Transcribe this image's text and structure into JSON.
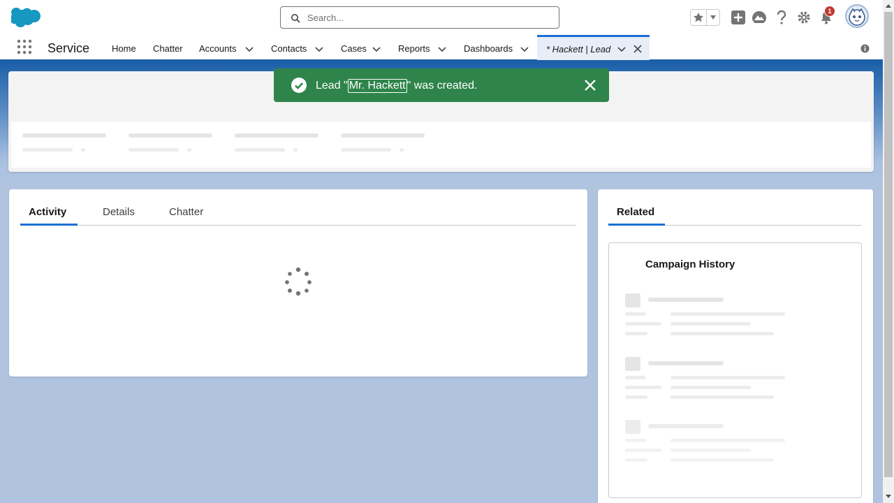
{
  "header": {
    "search_placeholder": "Search...",
    "notification_count": "1"
  },
  "nav": {
    "app_name": "Service",
    "items": [
      {
        "label": "Home"
      },
      {
        "label": "Chatter"
      },
      {
        "label": "Accounts"
      },
      {
        "label": "Contacts"
      },
      {
        "label": "Cases"
      },
      {
        "label": "Reports"
      },
      {
        "label": "Dashboards"
      }
    ],
    "active_tab_label": "* Hackett | Lead"
  },
  "toast": {
    "prefix": "Lead \"",
    "link": "Mr. Hackett",
    "suffix": "\" was created."
  },
  "main_tabs": {
    "activity": "Activity",
    "details": "Details",
    "chatter": "Chatter"
  },
  "side": {
    "tab": "Related",
    "card_title": "Campaign History"
  },
  "colors": {
    "brand": "#1b6ed4",
    "success": "#2e844a",
    "badge": "#c23934"
  }
}
